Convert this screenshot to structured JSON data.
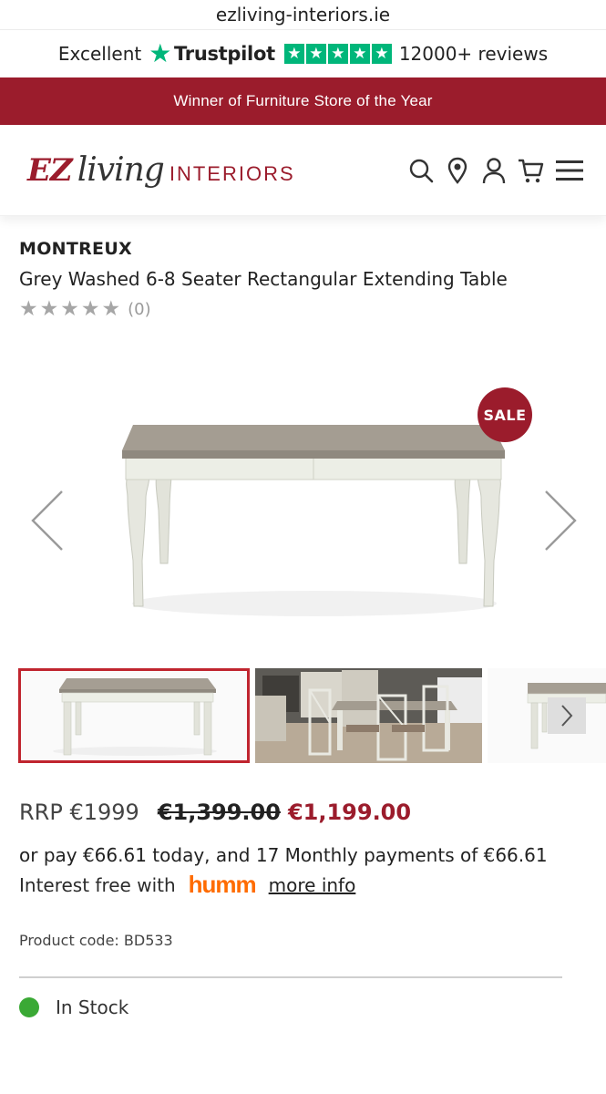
{
  "browser": {
    "url": "ezliving-interiors.ie"
  },
  "trustbar": {
    "rating_word": "Excellent",
    "brand": "Trustpilot",
    "reviews": "12000+ reviews",
    "brand_color": "#00b67a",
    "icon": "star-icon"
  },
  "promo": {
    "text": "Winner of Furniture Store of the Year",
    "color": "#9b1c2c"
  },
  "header": {
    "logo": {
      "ez": "EZ",
      "living": "living",
      "interiors": "INTERIORS"
    },
    "icons": [
      "search-icon",
      "location-pin-icon",
      "account-icon",
      "cart-icon",
      "menu-icon"
    ]
  },
  "product": {
    "brand": "MONTREUX",
    "title": "Grey Washed 6-8 Seater Rectangular Extending Table",
    "rating": {
      "stars": 0,
      "max": 5,
      "count": "(0)"
    },
    "sale_badge": "SALE"
  },
  "gallery": {
    "thumbnails": [
      "table-front",
      "dining-room-scene",
      "table-side"
    ]
  },
  "pricing": {
    "rrp": "RRP €1999",
    "was": "€1,399.00",
    "now": "€1,199.00",
    "finance_text": "or pay €66.61 today, and 17 Monthly payments of €66.61",
    "interest_free": "Interest free with",
    "humm": "humm",
    "more_info": "more info",
    "accent_color": "#9b1c2c"
  },
  "details": {
    "product_code": "Product code: BD533",
    "stock": "In Stock",
    "stock_color": "#3aa935"
  }
}
